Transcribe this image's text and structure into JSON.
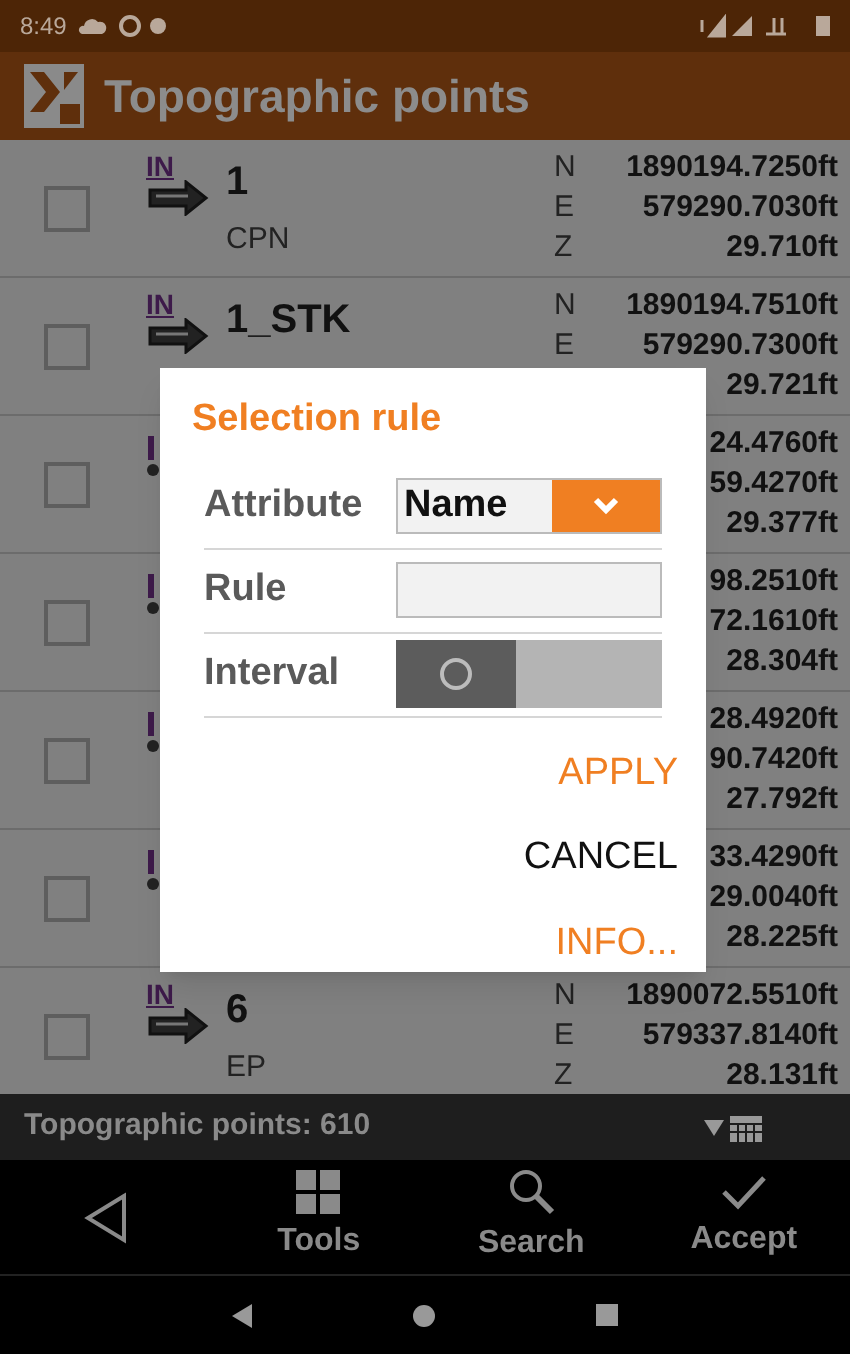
{
  "status_bar": {
    "time": "8:49"
  },
  "app_bar": {
    "title": "Topographic points"
  },
  "points": [
    {
      "kind": "full",
      "checked": false,
      "tag": "IN",
      "name": "1",
      "code": "CPN",
      "coords": [
        {
          "axis": "N",
          "value": "1890194.7250ft"
        },
        {
          "axis": "E",
          "value": "579290.7030ft"
        },
        {
          "axis": "Z",
          "value": "29.710ft"
        }
      ]
    },
    {
      "kind": "full",
      "checked": false,
      "tag": "IN",
      "name": "1_STK",
      "coords": [
        {
          "axis": "N",
          "value": "1890194.7510ft"
        },
        {
          "axis": "E",
          "value": "579290.7300ft"
        },
        {
          "value": "29.721ft"
        }
      ]
    },
    {
      "kind": "covered",
      "checked": false,
      "coords": [
        {
          "value": "24.4760ft"
        },
        {
          "value": "59.4270ft"
        },
        {
          "value": "29.377ft"
        }
      ]
    },
    {
      "kind": "covered",
      "checked": false,
      "coords": [
        {
          "value": "98.2510ft"
        },
        {
          "value": "72.1610ft"
        },
        {
          "value": "28.304ft"
        }
      ]
    },
    {
      "kind": "covered",
      "checked": false,
      "coords": [
        {
          "value": "28.4920ft"
        },
        {
          "value": "90.7420ft"
        },
        {
          "value": "27.792ft"
        }
      ]
    },
    {
      "kind": "covered",
      "checked": false,
      "coords": [
        {
          "value": "33.4290ft"
        },
        {
          "value": "29.0040ft"
        },
        {
          "value": "28.225ft"
        }
      ]
    },
    {
      "kind": "full",
      "checked": false,
      "tag": "IN",
      "name": "6",
      "code": "EP",
      "coords": [
        {
          "axis": "N",
          "value": "1890072.5510ft"
        },
        {
          "axis": "E",
          "value": "579337.8140ft"
        },
        {
          "axis": "Z",
          "value": "28.131ft"
        }
      ]
    }
  ],
  "footer": {
    "count": "Topographic points: 610"
  },
  "toolbar": [
    {
      "kind": "back"
    },
    {
      "kind": "tools",
      "label": "Tools"
    },
    {
      "kind": "search",
      "label": "Search"
    },
    {
      "kind": "accept",
      "label": "Accept"
    }
  ],
  "dialog": {
    "title": "Selection rule",
    "fields": [
      {
        "kind": "select",
        "label": "Attribute",
        "value": "Name"
      },
      {
        "kind": "text",
        "label": "Rule"
      },
      {
        "kind": "switch",
        "label": "Interval",
        "on": false
      }
    ],
    "actions": [
      {
        "kind": "primary",
        "label": "APPLY"
      },
      {
        "kind": "neutral",
        "label": "CANCEL"
      },
      {
        "kind": "primary",
        "label": "INFO..."
      }
    ]
  }
}
